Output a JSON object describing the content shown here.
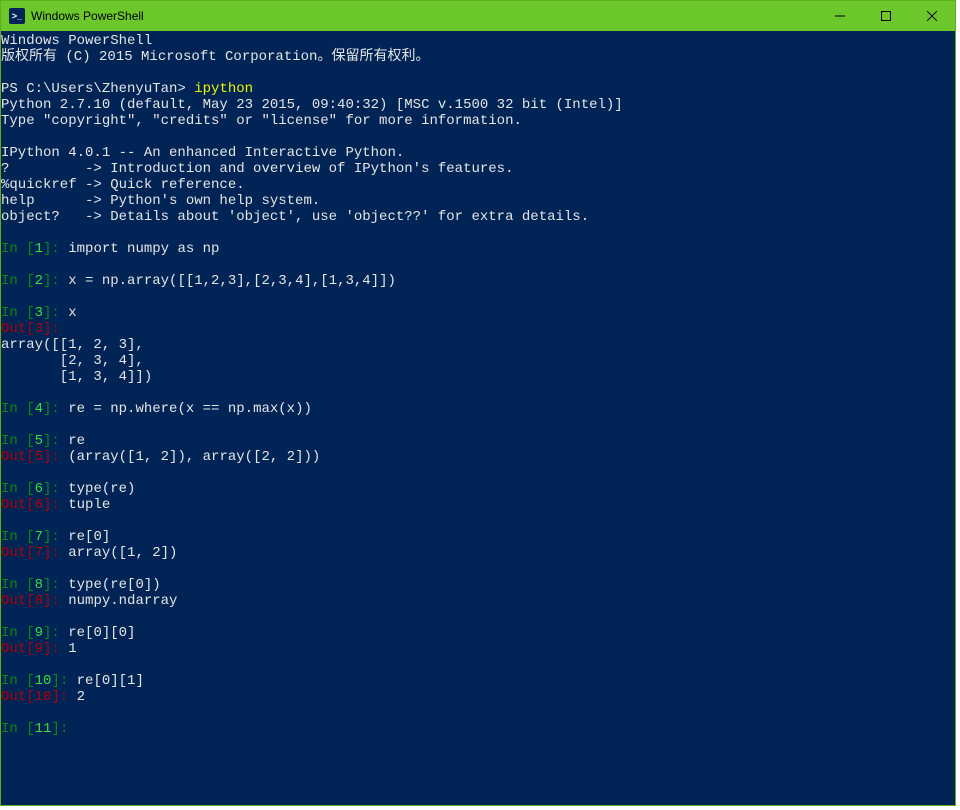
{
  "titlebar": {
    "icon_text": ">_",
    "title": "Windows PowerShell"
  },
  "header": {
    "l1": "Windows PowerShell",
    "l2": "版权所有 (C) 2015 Microsoft Corporation。保留所有权利。"
  },
  "prompt": {
    "path": "PS C:\\Users\\ZhenyuTan> ",
    "cmd": "ipython"
  },
  "banner": {
    "py": "Python 2.7.10 (default, May 23 2015, 09:40:32) [MSC v.1500 32 bit (Intel)]",
    "info": "Type \"copyright\", \"credits\" or \"license\" for more information.",
    "ipy": "IPython 4.0.1 -- An enhanced Interactive Python.",
    "h1": "?         -> Introduction and overview of IPython's features.",
    "h2": "%quickref -> Quick reference.",
    "h3": "help      -> Python's own help system.",
    "h4": "object?   -> Details about 'object', use 'object??' for extra details."
  },
  "cells": [
    {
      "in_n": "1",
      "in_code": "import numpy as np"
    },
    {
      "in_n": "2",
      "in_code": "x = np.array([[1,2,3],[2,3,4],[1,3,4]])"
    },
    {
      "in_n": "3",
      "in_code": "x",
      "out_n": "3",
      "out_text": "",
      "extra": "array([[1, 2, 3],\n       [2, 3, 4],\n       [1, 3, 4]])"
    },
    {
      "in_n": "4",
      "in_code": "re = np.where(x == np.max(x))"
    },
    {
      "in_n": "5",
      "in_code": "re",
      "out_n": "5",
      "out_text": "(array([1, 2]), array([2, 2]))"
    },
    {
      "in_n": "6",
      "in_code": "type(re)",
      "out_n": "6",
      "out_text": "tuple"
    },
    {
      "in_n": "7",
      "in_code": "re[0]",
      "out_n": "7",
      "out_text": "array([1, 2])"
    },
    {
      "in_n": "8",
      "in_code": "type(re[0])",
      "out_n": "8",
      "out_text": "numpy.ndarray"
    },
    {
      "in_n": "9",
      "in_code": "re[0][0]",
      "out_n": "9",
      "out_text": "1"
    },
    {
      "in_n": "10",
      "in_code": "re[0][1]",
      "out_n": "10",
      "out_text": "2"
    },
    {
      "in_n": "11",
      "in_code": ""
    }
  ],
  "tokens": {
    "in_pre": "In [",
    "in_suf": "]: ",
    "out_pre": "Out[",
    "out_suf": "]: "
  }
}
